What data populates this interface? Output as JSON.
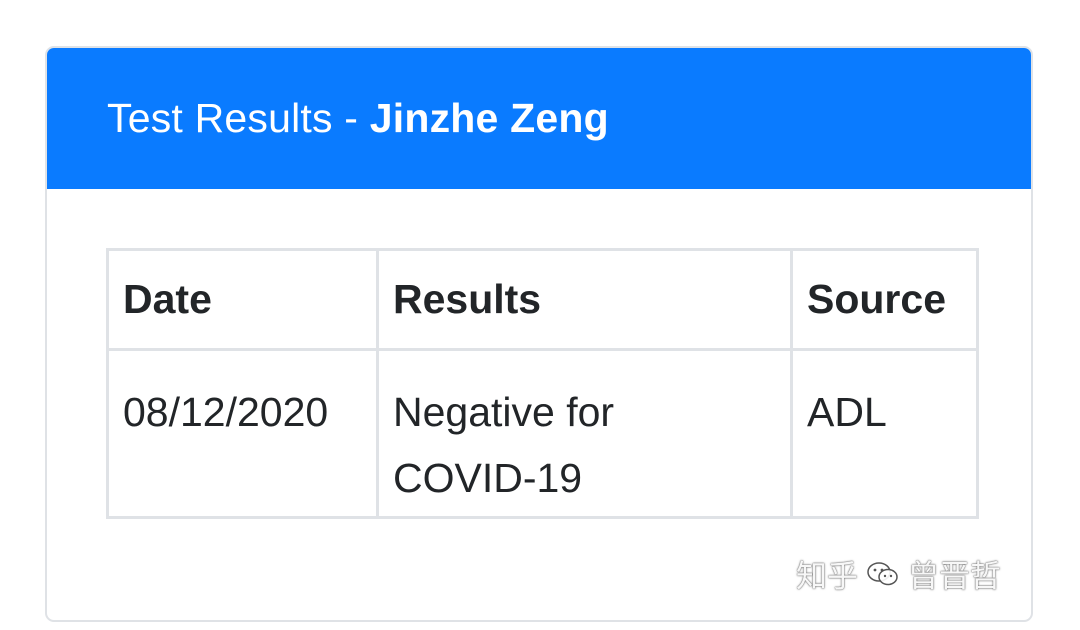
{
  "card": {
    "title_prefix": "Test Results - ",
    "title_name": "Jinzhe Zeng"
  },
  "table": {
    "headers": [
      "Date",
      "Results",
      "Source"
    ],
    "rows": [
      {
        "date": "08/12/2020",
        "result_line1": "Negative for",
        "result_line2": "COVID-19",
        "source": "ADL"
      }
    ]
  },
  "watermark": {
    "platform": "知乎",
    "author": "曾晋哲",
    "icon": "wechat-icon"
  },
  "colors": {
    "header_bg": "#0a7bff",
    "border": "#dfe2e6",
    "text": "#222528"
  }
}
